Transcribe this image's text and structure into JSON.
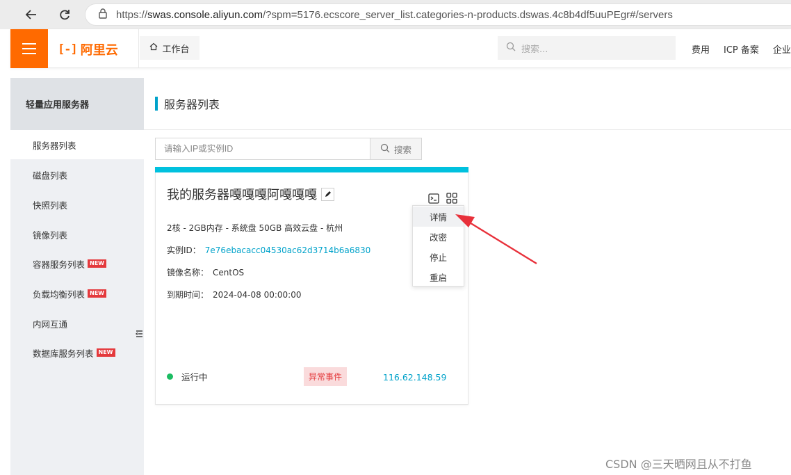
{
  "browser": {
    "url_prefix": "https://",
    "url_domain": "swas.console.aliyun.com",
    "url_rest": "/?spm=5176.ecscore_server_list.categories-n-products.dswas.4c8b4df5uuPEgr#/servers"
  },
  "header": {
    "logo_text": "阿里云",
    "workbench_label": "工作台",
    "search_placeholder": "搜索...",
    "links": [
      "费用",
      "ICP 备案",
      "企业"
    ]
  },
  "sidebar": {
    "title": "轻量应用服务器",
    "items": [
      {
        "label": "服务器列表",
        "active": true,
        "new": false
      },
      {
        "label": "磁盘列表",
        "active": false,
        "new": false
      },
      {
        "label": "快照列表",
        "active": false,
        "new": false
      },
      {
        "label": "镜像列表",
        "active": false,
        "new": false
      },
      {
        "label": "容器服务列表",
        "active": false,
        "new": true
      },
      {
        "label": "负载均衡列表",
        "active": false,
        "new": true
      },
      {
        "label": "内网互通",
        "active": false,
        "new": false
      },
      {
        "label": "数据库服务列表",
        "active": false,
        "new": true
      }
    ],
    "new_badge": "NEW"
  },
  "main": {
    "title": "服务器列表",
    "search": {
      "placeholder": "请输入IP或实例ID",
      "button_label": "搜索"
    }
  },
  "card": {
    "name": "我的服务器嘎嘎嘎阿嘎嘎嘎",
    "spec": "2核 - 2GB内存 - 系统盘 50GB 高效云盘 - 杭州",
    "instance_id_label": "实例ID：",
    "instance_id": "7e76ebacacc04530ac62d3714b6a6830",
    "image_label": "镜像名称：",
    "image_name": "CentOS",
    "expire_label": "到期时间：",
    "expire_time": "2024-04-08 00:00:00",
    "status": "运行中",
    "alert_label": "异常事件",
    "public_ip": "116.62.148.59"
  },
  "dropdown": {
    "items": [
      "详情",
      "改密",
      "停止",
      "重启"
    ]
  },
  "colors": {
    "brand": "#ff6a00",
    "accent": "#00c1de",
    "link": "#00a2ca",
    "running": "#1cbc62",
    "alert": "#e4393c",
    "annotation_arrow": "#e8303a"
  },
  "watermark": "CSDN @三天晒网且从不打鱼"
}
